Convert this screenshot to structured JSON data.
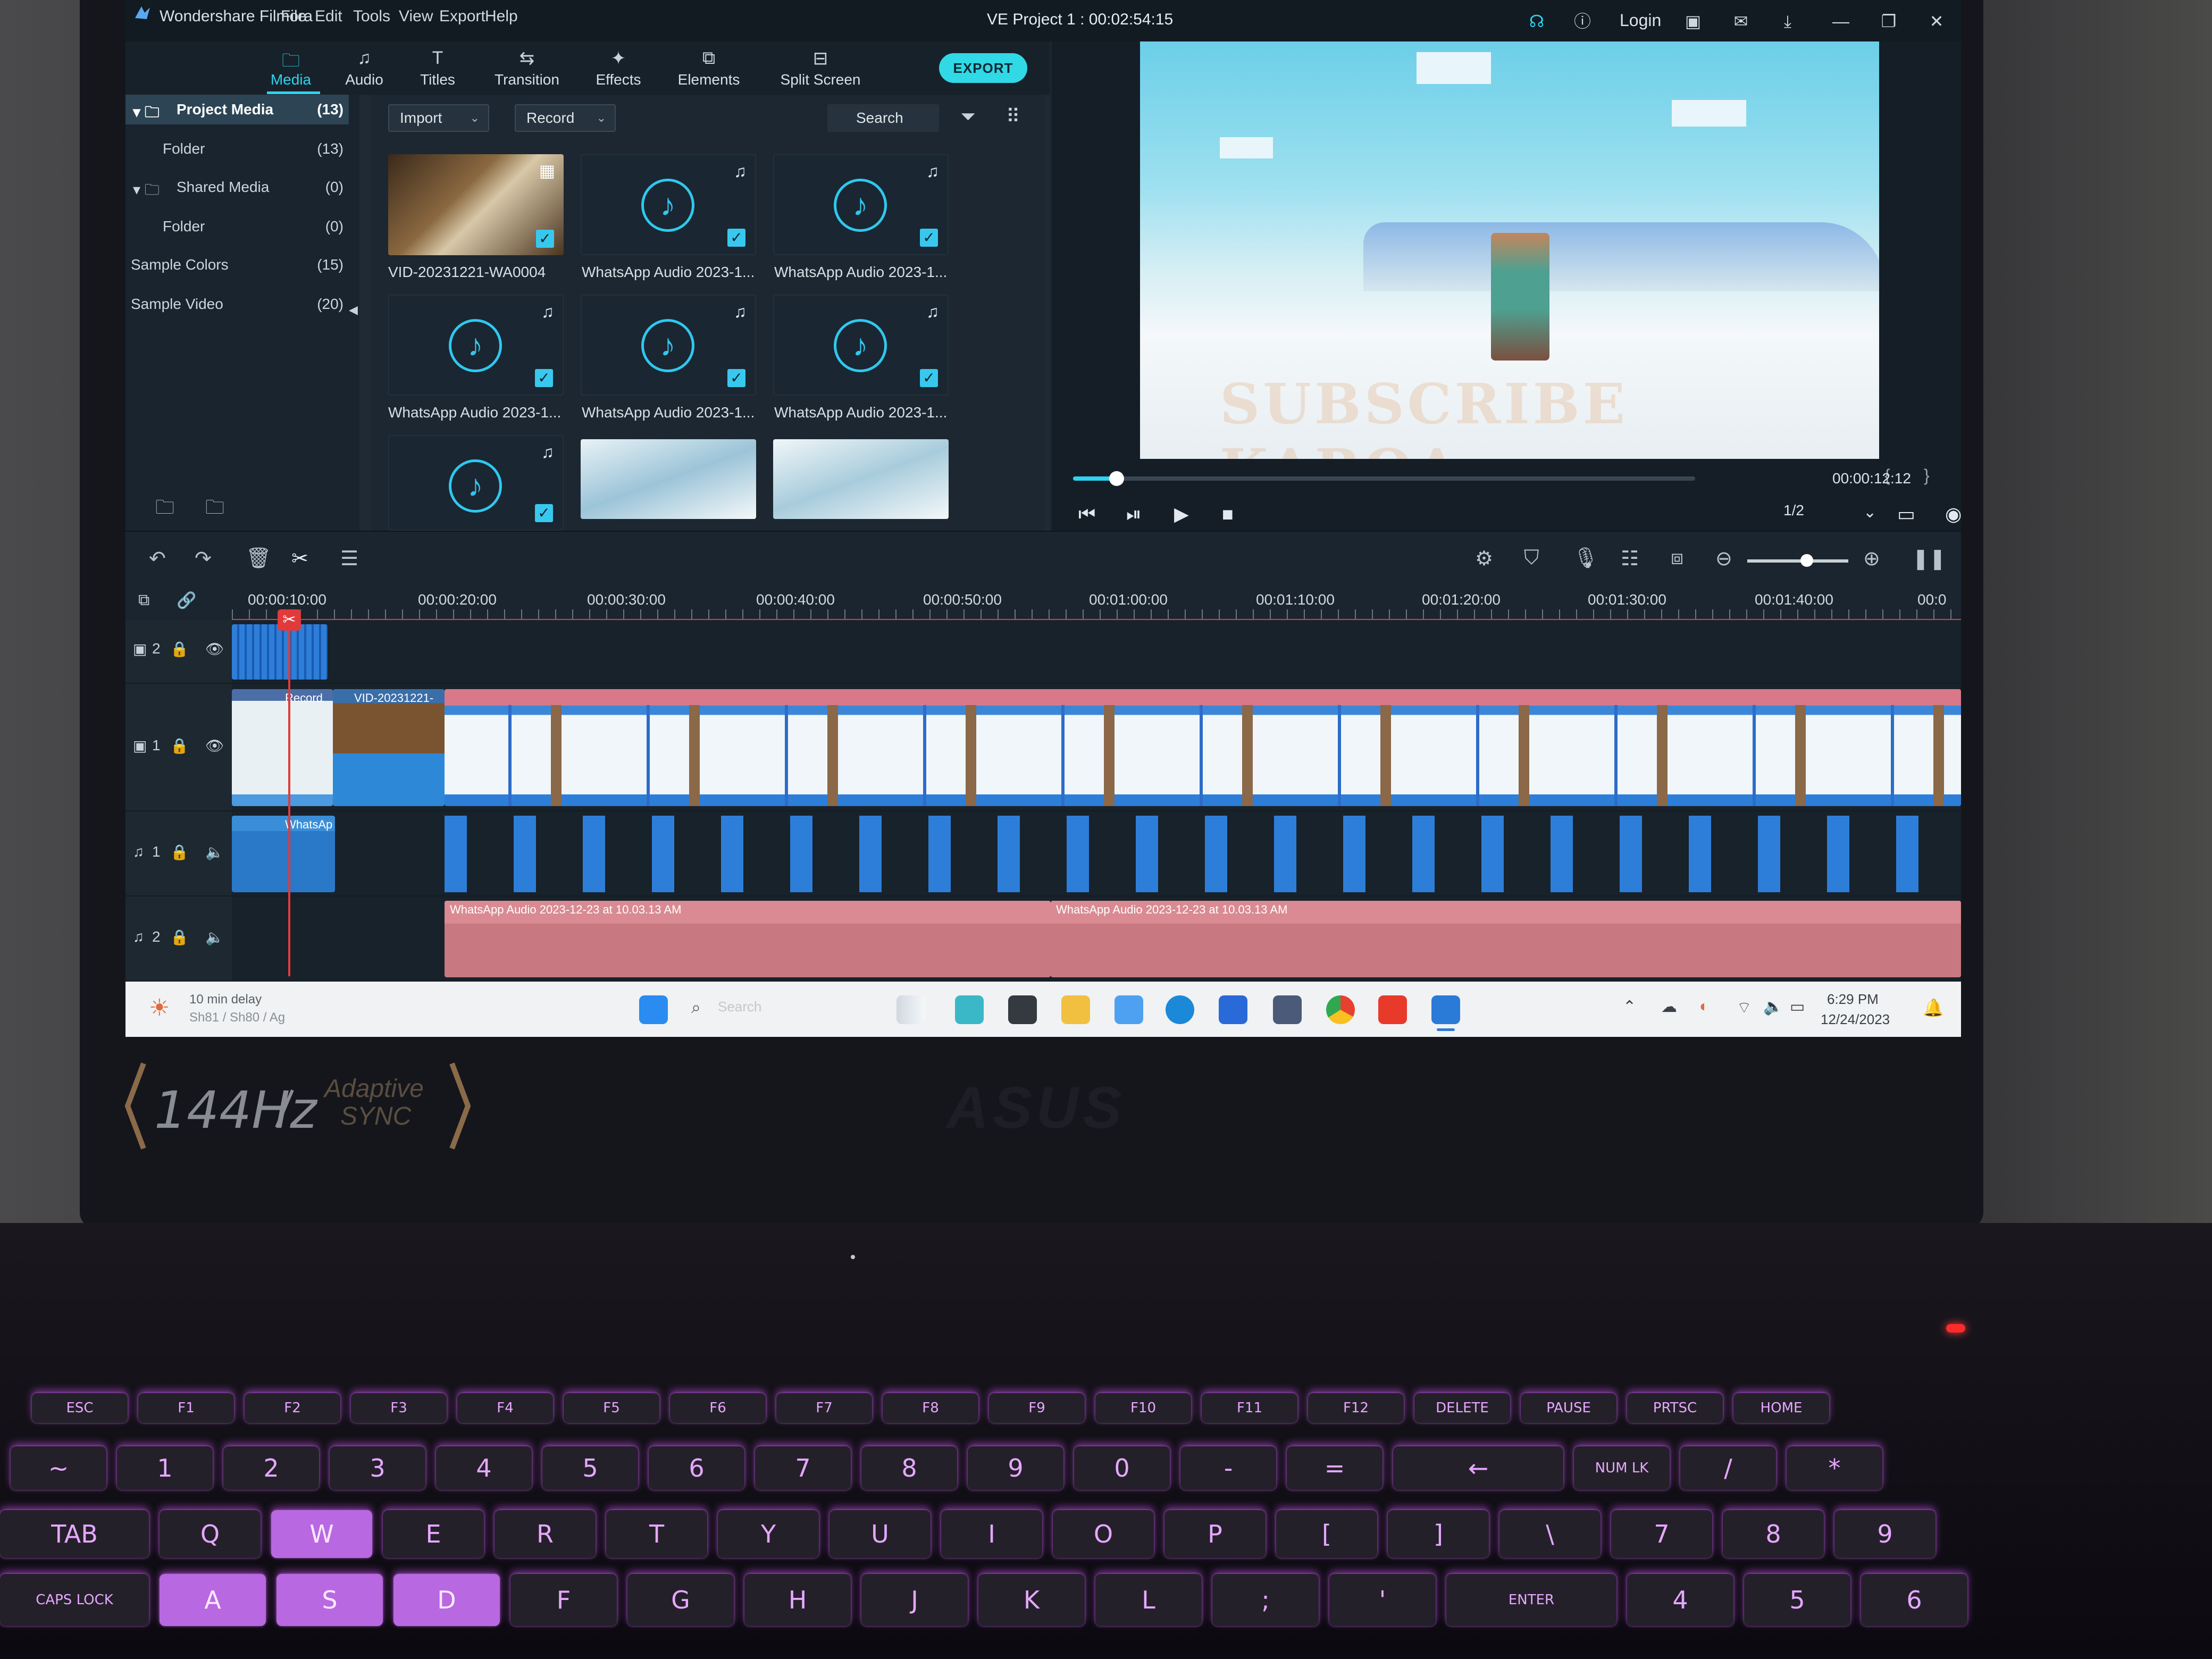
{
  "app": {
    "name": "Wondershare Filmora",
    "menu": [
      "File",
      "Edit",
      "Tools",
      "View",
      "Export",
      "Help"
    ],
    "project_title": "VE Project 1 : 00:02:54:15",
    "login": "Login"
  },
  "tabs": [
    {
      "label": "Media",
      "icon": "folder-icon",
      "active": true
    },
    {
      "label": "Audio",
      "icon": "music-icon"
    },
    {
      "label": "Titles",
      "icon": "text-icon"
    },
    {
      "label": "Transition",
      "icon": "transition-icon"
    },
    {
      "label": "Effects",
      "icon": "effects-icon"
    },
    {
      "label": "Elements",
      "icon": "elements-icon"
    },
    {
      "label": "Split Screen",
      "icon": "split-screen-icon"
    }
  ],
  "export_label": "EXPORT",
  "tree": [
    {
      "name": "Project Media",
      "count": "(13)",
      "selected": true
    },
    {
      "name": "Folder",
      "count": "(13)"
    },
    {
      "name": "Shared Media",
      "count": "(0)"
    },
    {
      "name": "Folder",
      "count": "(0)"
    },
    {
      "name": "Sample Colors",
      "count": "(15)"
    },
    {
      "name": "Sample Video",
      "count": "(20)"
    }
  ],
  "media_toolbar": {
    "import": "Import",
    "record": "Record",
    "search": "Search"
  },
  "media_items": [
    {
      "caption": "VID-20231221-WA0004",
      "kind": "video"
    },
    {
      "caption": "WhatsApp Audio 2023-1...",
      "kind": "audio"
    },
    {
      "caption": "WhatsApp Audio 2023-1...",
      "kind": "audio"
    },
    {
      "caption": "WhatsApp Audio 2023-1...",
      "kind": "audio"
    },
    {
      "caption": "WhatsApp Audio 2023-1...",
      "kind": "audio"
    },
    {
      "caption": "WhatsApp Audio 2023-1...",
      "kind": "audio"
    },
    {
      "caption": "",
      "kind": "audio"
    },
    {
      "caption": "",
      "kind": "video"
    },
    {
      "caption": "",
      "kind": "video"
    }
  ],
  "preview": {
    "overlay_text": "SUBSCRIBE KAROA",
    "timecode": "00:00:12:12",
    "quality": "1/2",
    "progress": 0.07
  },
  "ruler": [
    "00:00:10:00",
    "00:00:20:00",
    "00:00:30:00",
    "00:00:40:00",
    "00:00:50:00",
    "00:01:00:00",
    "00:01:10:00",
    "00:01:20:00",
    "00:01:30:00",
    "00:01:40:00",
    "00:0"
  ],
  "clips": {
    "record": "Record",
    "vid": "VID-20231221-",
    "whatsapp_short": "WhatsAp",
    "audio_a": "WhatsApp Audio 2023-12-23 at 10.03.13 AM",
    "audio_b": "WhatsApp Audio 2023-12-23 at 10.03.13 AM"
  },
  "track_labels": {
    "v2": "2",
    "v1": "1",
    "a1": "1",
    "a2": "2"
  },
  "taskbar": {
    "weather": "10 min delay",
    "weather_sub": "Sh81 / Sh80 / Ag",
    "search": "Search",
    "time": "6:29 PM",
    "date": "12/24/2023"
  },
  "hardware": {
    "refresh": "144Hz",
    "sync_line1": "Adaptive",
    "sync_line2": "SYNC",
    "brand": "ASUS"
  },
  "keyboard_rows": [
    [
      "ESC",
      "F1",
      "F2",
      "F3",
      "F4",
      "F5",
      "F6",
      "F7",
      "F8",
      "F9",
      "F10",
      "F11",
      "F12",
      "DELETE",
      "PAUSE",
      "PRTSC",
      "HOME"
    ],
    [
      "~",
      "1",
      "2",
      "3",
      "4",
      "5",
      "6",
      "7",
      "8",
      "9",
      "0",
      "-",
      "=",
      "←",
      "NUM LK",
      "/",
      "*"
    ],
    [
      "TAB",
      "Q",
      "W",
      "E",
      "R",
      "T",
      "Y",
      "U",
      "I",
      "O",
      "P",
      "[",
      "]",
      "\\",
      "7",
      "8",
      "9"
    ],
    [
      "CAPS LOCK",
      "A",
      "S",
      "D",
      "F",
      "G",
      "H",
      "J",
      "K",
      "L",
      ";",
      "'",
      "ENTER",
      "4",
      "5",
      "6"
    ]
  ],
  "colors": {
    "accent": "#2fd2f0",
    "playhead": "#e23a3a",
    "audio_clip": "#d98a92",
    "video_clip": "#3c9be0",
    "keyboard_glow": "#c060f0"
  }
}
